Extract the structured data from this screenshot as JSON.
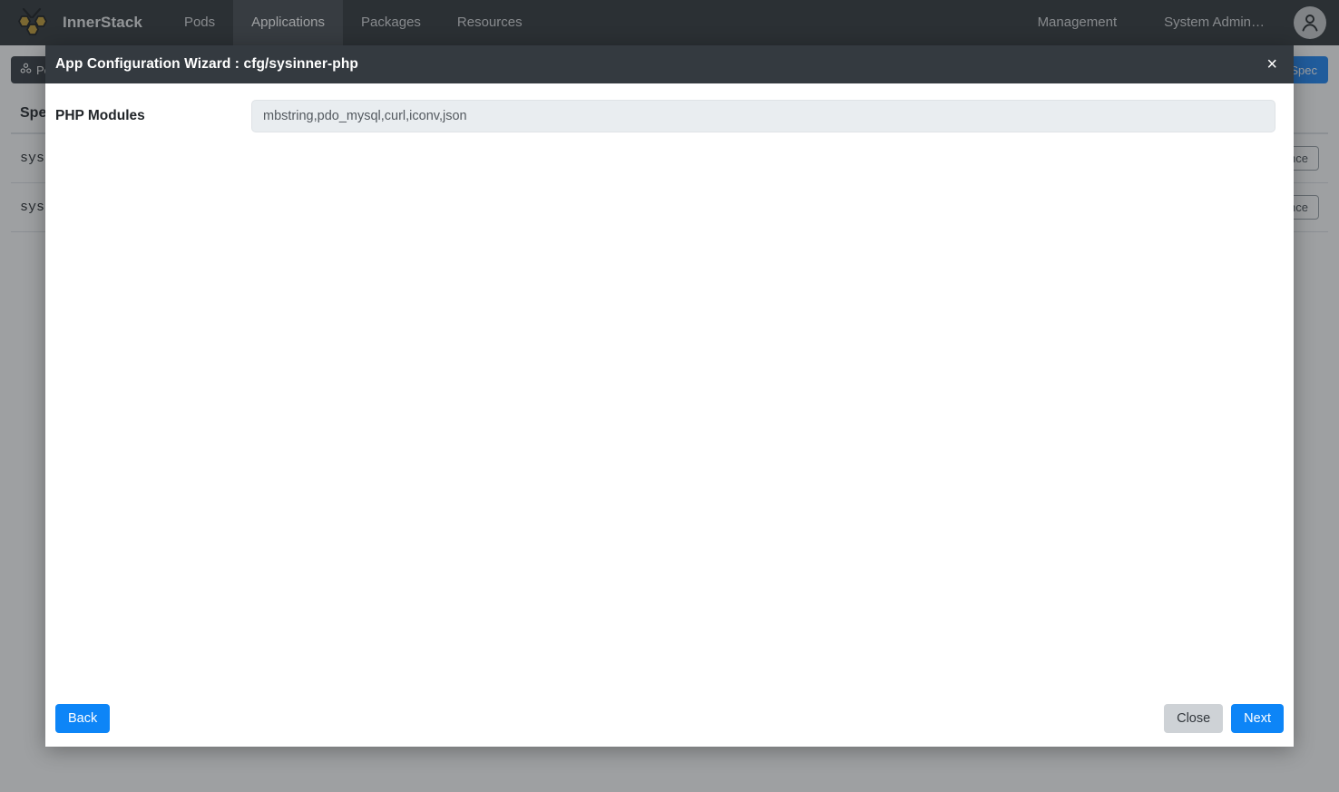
{
  "navbar": {
    "logo_icon": "honeycomb-bee-icon",
    "brand": "InnerStack",
    "links": [
      {
        "label": "Pods",
        "active": false
      },
      {
        "label": "Applications",
        "active": true
      },
      {
        "label": "Packages",
        "active": false
      },
      {
        "label": "Resources",
        "active": false
      }
    ],
    "right_links": [
      {
        "label": "Management"
      },
      {
        "label": "System Admin…"
      }
    ],
    "avatar_icon": "user-avatar-icon"
  },
  "background": {
    "toolbar": {
      "pod_button_label": "Pod",
      "pod_button_icon": "pod-icon",
      "new_spec_button_label": "New Spec"
    },
    "table": {
      "columns": [
        "Spec",
        ""
      ],
      "rows": [
        {
          "spec": "sysinner-php",
          "action_label": "New Instance"
        },
        {
          "spec": "sysinner-mysql",
          "action_label": "New Instance"
        }
      ]
    }
  },
  "modal": {
    "title": "App Configuration Wizard : cfg/sysinner-php",
    "close_icon": "close-icon",
    "close_label": "×",
    "fields": [
      {
        "label": "PHP Modules",
        "value": "mbstring,pdo_mysql,curl,iconv,json",
        "placeholder": ""
      }
    ],
    "footer": {
      "back_label": "Back",
      "close_label": "Close",
      "next_label": "Next"
    }
  },
  "colors": {
    "navbar_bg": "#2f3338",
    "modal_header_bg": "#343a40",
    "primary": "#0d85f7",
    "secondary": "#ced2d6",
    "input_bg": "#e9edf0",
    "logo_gold": "#c09a33"
  }
}
